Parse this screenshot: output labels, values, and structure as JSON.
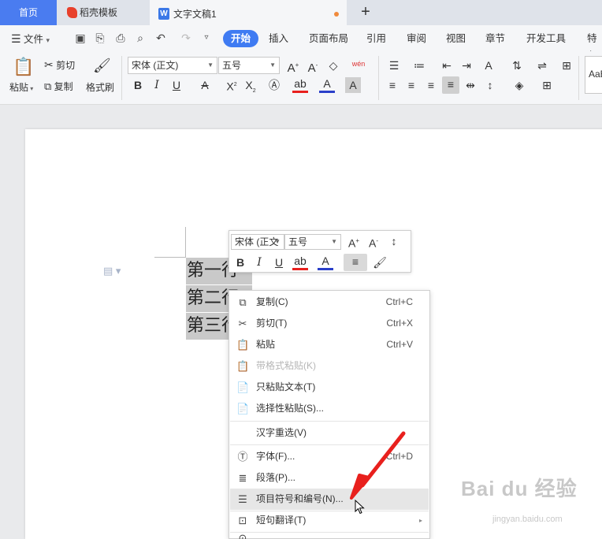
{
  "tabs": {
    "home": "首页",
    "template": "稻壳模板",
    "document": "文字文稿1"
  },
  "menubar": {
    "file": "文件",
    "items": [
      "开始",
      "插入",
      "页面布局",
      "引用",
      "审阅",
      "视图",
      "章节",
      "开发工具",
      "特色"
    ]
  },
  "ribbon": {
    "paste": "粘贴",
    "cut": "剪切",
    "copy": "复制",
    "format_painter": "格式刷",
    "font_name": "宋体 (正文)",
    "font_size": "五号",
    "style_preview": "AaB",
    "phonetic": "wén"
  },
  "document": {
    "lines": [
      "第一行",
      "第二行",
      "第三行"
    ]
  },
  "mini_toolbar": {
    "font_name": "宋体 (正文",
    "font_size": "五号"
  },
  "context_menu": {
    "items": [
      {
        "label": "复制(C)",
        "shortcut": "Ctrl+C",
        "icon": "copy-icon",
        "disabled": false
      },
      {
        "label": "剪切(T)",
        "shortcut": "Ctrl+X",
        "icon": "scissors-icon",
        "disabled": false
      },
      {
        "label": "粘贴",
        "shortcut": "Ctrl+V",
        "icon": "paste-icon",
        "disabled": false
      },
      {
        "label": "带格式粘贴(K)",
        "shortcut": "",
        "icon": "paste-formatted-icon",
        "disabled": true
      },
      {
        "label": "只粘贴文本(T)",
        "shortcut": "",
        "icon": "paste-text-icon",
        "disabled": false
      },
      {
        "label": "选择性粘贴(S)...",
        "shortcut": "",
        "icon": "paste-special-icon",
        "disabled": false
      },
      {
        "label": "汉字重选(V)",
        "shortcut": "",
        "icon": "",
        "disabled": false
      },
      {
        "label": "字体(F)...",
        "shortcut": "Ctrl+D",
        "icon": "font-icon",
        "disabled": false
      },
      {
        "label": "段落(P)...",
        "shortcut": "",
        "icon": "paragraph-icon",
        "disabled": false
      },
      {
        "label": "项目符号和编号(N)...",
        "shortcut": "",
        "icon": "bullets-icon",
        "disabled": false,
        "highlighted": true
      },
      {
        "label": "短句翻译(T)",
        "shortcut": "",
        "icon": "translate-icon",
        "disabled": false
      }
    ]
  },
  "watermark": {
    "brand": "Bai du 经验",
    "url": "jingyan.baidu.com"
  },
  "colors": {
    "accent": "#3f7bf2",
    "home_tab": "#4a7cf0",
    "selection": "#c9c9c9",
    "arrow": "#e8201d"
  }
}
